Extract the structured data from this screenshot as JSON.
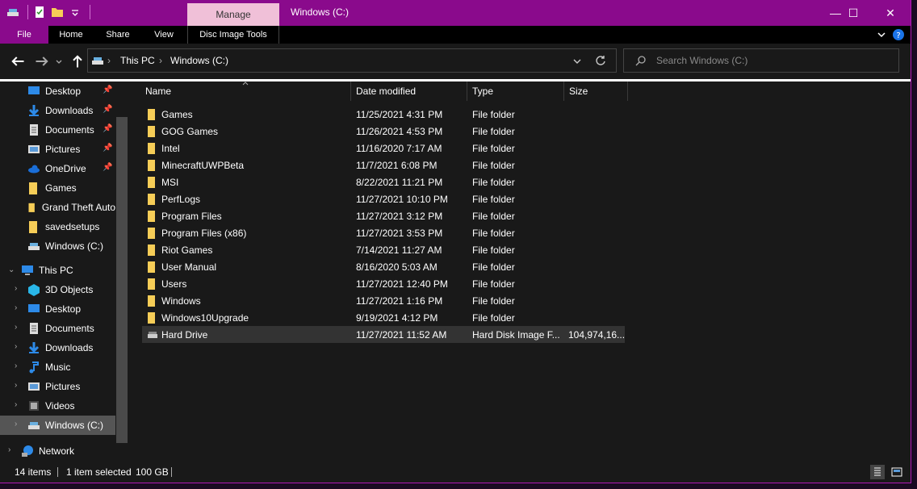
{
  "title_bar": {
    "contextual_tab": "Manage",
    "window_title": "Windows (C:)",
    "minimize_glyph": "—",
    "maximize_glyph": "☐",
    "close_glyph": "✕"
  },
  "ribbon": {
    "tabs": [
      {
        "label": "File"
      },
      {
        "label": "Home"
      },
      {
        "label": "Share"
      },
      {
        "label": "View"
      },
      {
        "label": "Disc Image Tools"
      }
    ]
  },
  "address_bar": {
    "breadcrumbs": [
      "This PC",
      "Windows (C:)"
    ],
    "search_placeholder": "Search Windows (C:)"
  },
  "nav_pane": {
    "quick_access": [
      {
        "label": "Desktop",
        "icon": "desktop-icon",
        "pinned": true
      },
      {
        "label": "Downloads",
        "icon": "download-icon",
        "pinned": true
      },
      {
        "label": "Documents",
        "icon": "document-icon",
        "pinned": true
      },
      {
        "label": "Pictures",
        "icon": "pictures-icon",
        "pinned": true
      },
      {
        "label": "OneDrive",
        "icon": "cloud-icon",
        "pinned": true
      },
      {
        "label": "Games",
        "icon": "folder-icon",
        "pinned": false
      },
      {
        "label": "Grand Theft Auto",
        "icon": "folder-icon",
        "pinned": false
      },
      {
        "label": "savedsetups",
        "icon": "folder-icon",
        "pinned": false
      },
      {
        "label": "Windows (C:)",
        "icon": "drive-icon",
        "pinned": false
      }
    ],
    "this_pc": {
      "label": "This PC"
    },
    "this_pc_items": [
      {
        "label": "3D Objects",
        "icon": "cube-icon"
      },
      {
        "label": "Desktop",
        "icon": "desktop-icon"
      },
      {
        "label": "Documents",
        "icon": "document-icon"
      },
      {
        "label": "Downloads",
        "icon": "download-icon"
      },
      {
        "label": "Music",
        "icon": "music-icon"
      },
      {
        "label": "Pictures",
        "icon": "pictures-icon"
      },
      {
        "label": "Videos",
        "icon": "video-icon"
      },
      {
        "label": "Windows (C:)",
        "icon": "drive-icon"
      }
    ],
    "network": {
      "label": "Network"
    }
  },
  "file_list": {
    "columns": {
      "name": "Name",
      "date": "Date modified",
      "type": "Type",
      "size": "Size"
    },
    "rows": [
      {
        "name": "Games",
        "date": "11/25/2021 4:31 PM",
        "type": "File folder",
        "size": ""
      },
      {
        "name": "GOG Games",
        "date": "11/26/2021 4:53 PM",
        "type": "File folder",
        "size": ""
      },
      {
        "name": "Intel",
        "date": "11/16/2020 7:17 AM",
        "type": "File folder",
        "size": ""
      },
      {
        "name": "MinecraftUWPBeta",
        "date": "11/7/2021 6:08 PM",
        "type": "File folder",
        "size": ""
      },
      {
        "name": "MSI",
        "date": "8/22/2021 11:21 PM",
        "type": "File folder",
        "size": ""
      },
      {
        "name": "PerfLogs",
        "date": "11/27/2021 10:10 PM",
        "type": "File folder",
        "size": ""
      },
      {
        "name": "Program Files",
        "date": "11/27/2021 3:12 PM",
        "type": "File folder",
        "size": ""
      },
      {
        "name": "Program Files (x86)",
        "date": "11/27/2021 3:53 PM",
        "type": "File folder",
        "size": ""
      },
      {
        "name": "Riot Games",
        "date": "7/14/2021 11:27 AM",
        "type": "File folder",
        "size": ""
      },
      {
        "name": "User Manual",
        "date": "8/16/2020 5:03 AM",
        "type": "File folder",
        "size": ""
      },
      {
        "name": "Users",
        "date": "11/27/2021 12:40 PM",
        "type": "File folder",
        "size": ""
      },
      {
        "name": "Windows",
        "date": "11/27/2021 1:16 PM",
        "type": "File folder",
        "size": ""
      },
      {
        "name": "Windows10Upgrade",
        "date": "9/19/2021 4:12 PM",
        "type": "File folder",
        "size": ""
      },
      {
        "name": "Hard Drive",
        "date": "11/27/2021 11:52 AM",
        "type": "Hard Disk Image F...",
        "size": "104,974,16..."
      }
    ]
  },
  "status_bar": {
    "item_count": "14 items",
    "selection": "1 item selected",
    "selection_size": "100 GB"
  },
  "colors": {
    "accent": "#8a0a8c",
    "manage_tab": "#f0c0d8",
    "background": "#191919",
    "folder": "#f6cd57"
  }
}
